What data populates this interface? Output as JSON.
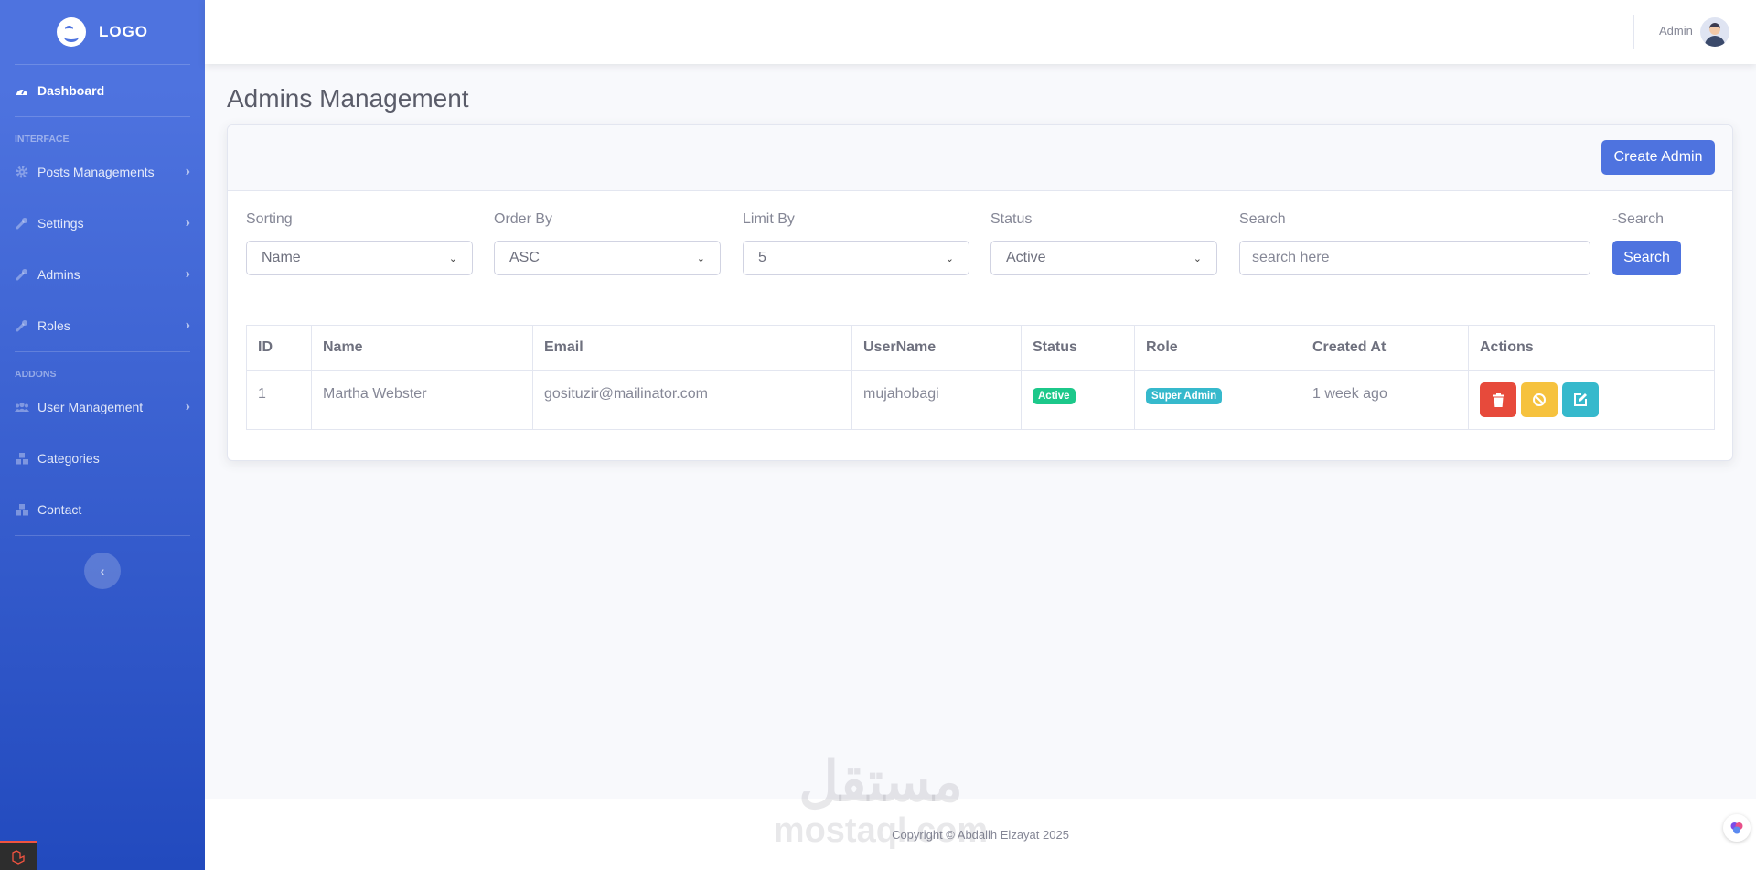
{
  "brand": {
    "text": "LOGO",
    "icon": "smile-logo-icon"
  },
  "sidebar": {
    "dashboard": {
      "label": "Dashboard",
      "icon": "tachometer-icon"
    },
    "heading_interface": "INTERFACE",
    "interface_items": [
      {
        "label": "Posts Managements",
        "icon": "cog-icon"
      },
      {
        "label": "Settings",
        "icon": "wrench-icon"
      },
      {
        "label": "Admins",
        "icon": "wrench-icon"
      },
      {
        "label": "Roles",
        "icon": "wrench-icon"
      }
    ],
    "heading_addons": "ADDONS",
    "addons_items": [
      {
        "label": "User Management",
        "icon": "users-icon",
        "chevron": true
      },
      {
        "label": "Categories",
        "icon": "cubes-icon",
        "chevron": false
      },
      {
        "label": "Contact",
        "icon": "cubes-icon",
        "chevron": false
      }
    ]
  },
  "topbar": {
    "user_name": "Admin"
  },
  "page": {
    "title": "Admins Management"
  },
  "card": {
    "create_button": "Create Admin"
  },
  "filters": {
    "sorting": {
      "label": "Sorting",
      "value": "Name"
    },
    "order_by": {
      "label": "Order By",
      "value": "ASC"
    },
    "limit_by": {
      "label": "Limit By",
      "value": "5"
    },
    "status": {
      "label": "Status",
      "value": "Active"
    },
    "search": {
      "label": "Search",
      "placeholder": "search here"
    },
    "search_button": {
      "label": "-Search",
      "button": "Search"
    }
  },
  "table": {
    "headers": [
      "ID",
      "Name",
      "Email",
      "UserName",
      "Status",
      "Role",
      "Created At",
      "Actions"
    ],
    "rows": [
      {
        "id": "1",
        "name": "Martha Webster",
        "email": "gosituzir@mailinator.com",
        "username": "mujahobagi",
        "status": "Active",
        "role": "Super Admin",
        "created_at": "1 week ago"
      }
    ]
  },
  "footer": {
    "copyright": "Copyright © Abdallh Elzayat 2025"
  },
  "watermark": {
    "arabic": "مستقل",
    "latin": "mostaql.com"
  },
  "colors": {
    "primary": "#4e73df",
    "success": "#1cc88a",
    "info": "#36b9cc",
    "danger": "#e74a3b",
    "warning": "#f6c23e"
  }
}
